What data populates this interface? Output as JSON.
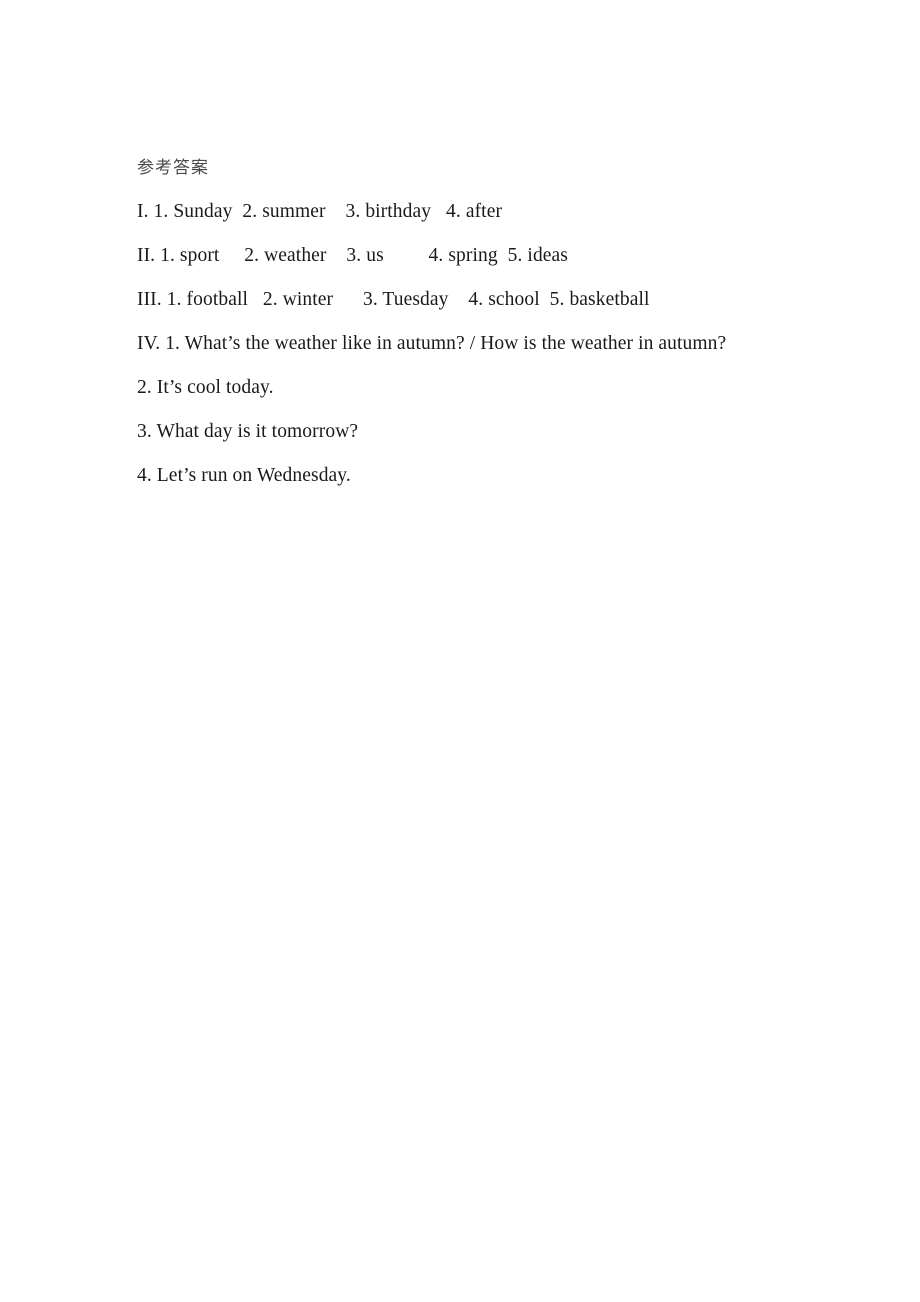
{
  "document": {
    "heading": "参考答案",
    "lines": [
      {
        "id": "section-1",
        "text": "I. 1. Sunday  2. summer    3. birthday   4. after"
      },
      {
        "id": "section-2",
        "text": "II. 1. sport     2. weather    3. us         4. spring  5. ideas"
      },
      {
        "id": "section-3",
        "text": "III. 1. football   2. winter      3. Tuesday    4. school  5. basketball"
      },
      {
        "id": "section-4-q1",
        "text": "IV. 1. What’s the weather like in autumn? / How is the weather in autumn?"
      },
      {
        "id": "section-4-q2",
        "text": "2. It’s cool today."
      },
      {
        "id": "section-4-q3",
        "text": "3. What day is it tomorrow?"
      },
      {
        "id": "section-4-q4",
        "text": "4. Let’s run on Wednesday."
      }
    ]
  },
  "style": {
    "page_background": "#ffffff",
    "heading_color": "#4a4a4a",
    "body_text_color": "#1a1a1a"
  }
}
